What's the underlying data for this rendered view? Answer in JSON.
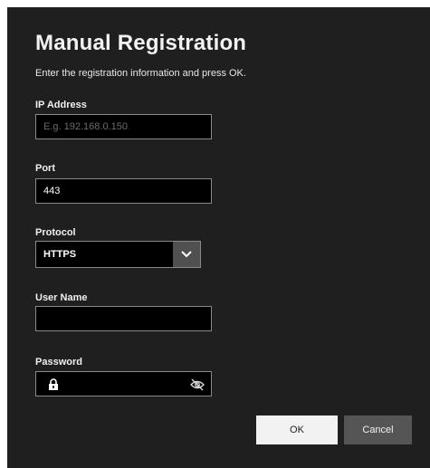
{
  "dialog": {
    "title": "Manual Registration",
    "subtitle": "Enter the registration information and press OK."
  },
  "fields": {
    "ip_address": {
      "label": "IP Address",
      "value": "",
      "placeholder": "E.g. 192.168.0.150"
    },
    "port": {
      "label": "Port",
      "value": "443"
    },
    "protocol": {
      "label": "Protocol",
      "selected": "HTTPS"
    },
    "user_name": {
      "label": "User Name",
      "value": ""
    },
    "password": {
      "label": "Password",
      "value": ""
    }
  },
  "buttons": {
    "ok_label": "OK",
    "cancel_label": "Cancel"
  },
  "icons": {
    "protocol_dropdown": "chevron-down-icon",
    "password_lock": "lock-icon",
    "password_visibility": "eye-off-icon"
  },
  "colors": {
    "dialog_bg": "#1f1f1f",
    "field_bg": "#000000",
    "field_border": "#8a8a8a",
    "ok_bg": "#f2f2f2",
    "cancel_bg": "#555555"
  }
}
